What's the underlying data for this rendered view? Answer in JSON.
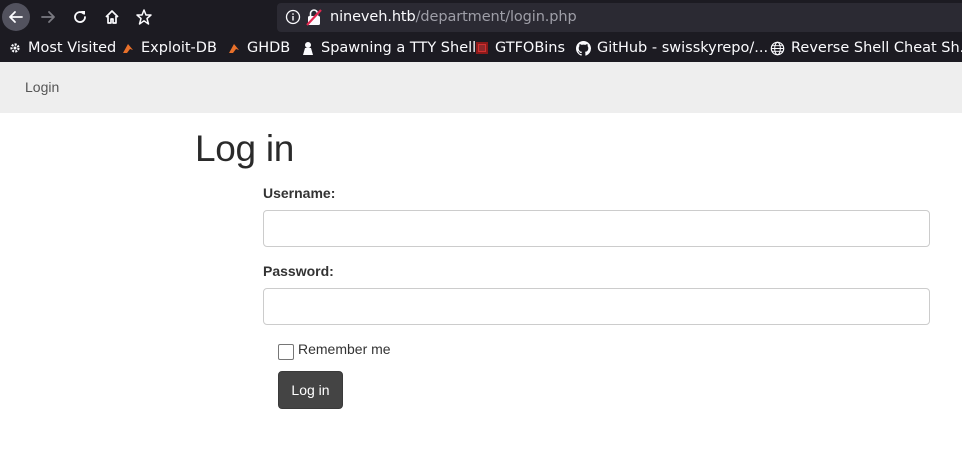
{
  "browser": {
    "url_host": "nineveh.htb",
    "url_path": "/department/login.php",
    "bookmarks": [
      {
        "label": "Most Visited",
        "icon": "gear-icon"
      },
      {
        "label": "Exploit-DB",
        "icon": "exploit-db-icon"
      },
      {
        "label": "GHDB",
        "icon": "ghdb-icon"
      },
      {
        "label": "Spawning a TTY Shell",
        "icon": "tty-shell-icon"
      },
      {
        "label": "GTFOBins",
        "icon": "gtfobins-icon"
      },
      {
        "label": "GitHub - swisskyrepo/...",
        "icon": "github-icon"
      },
      {
        "label": "Reverse Shell Cheat Sh...",
        "icon": "globe-icon"
      }
    ]
  },
  "navbar": {
    "link_label": "Login"
  },
  "form": {
    "title": "Log in",
    "username_label": "Username:",
    "username_value": "",
    "password_label": "Password:",
    "password_value": "",
    "remember_label": "Remember me",
    "remember_checked": false,
    "submit_label": "Log in"
  },
  "colors": {
    "chrome_bg": "#1c1b22",
    "urlbar_bg": "#2b2a33",
    "navbar_bg": "#eeeeee",
    "button_bg": "#444444"
  }
}
